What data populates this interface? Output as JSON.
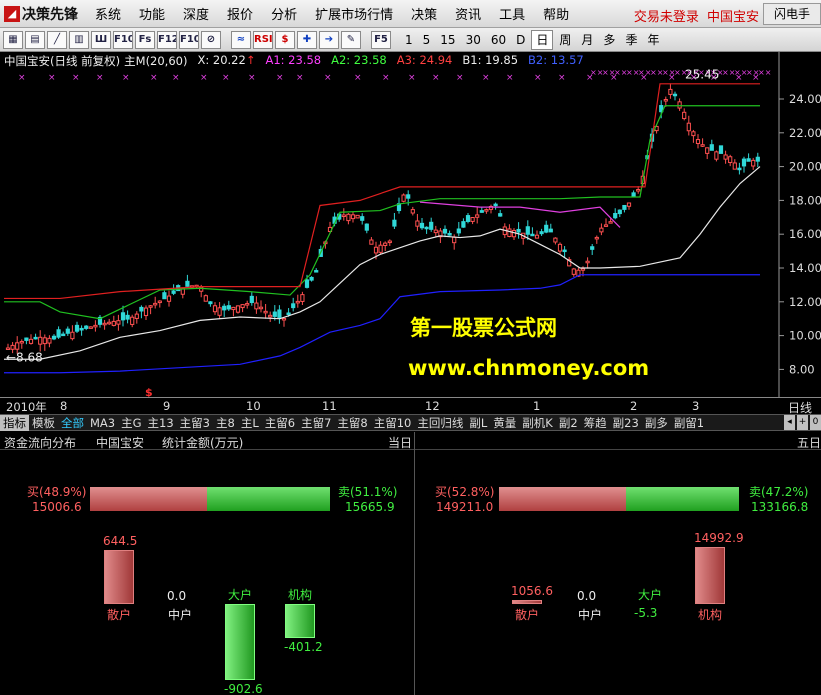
{
  "menubar": {
    "logo": "决策先锋",
    "items": [
      "系统",
      "功能",
      "深度",
      "报价",
      "分析",
      "扩展市场行情",
      "决策",
      "资讯",
      "工具",
      "帮助"
    ],
    "status": "交易未登录",
    "stock": "中国宝安",
    "flash_button": "闪电手"
  },
  "toolbar": {
    "icons": [
      "grid",
      "table",
      "line",
      "bar",
      "kline",
      "F10",
      "F9",
      "F12",
      "F10",
      "zoom",
      "wave",
      "RSI",
      "$",
      "cross",
      "arrow",
      "pen",
      "F5"
    ],
    "icon_labels": [
      "▦",
      "▤",
      "╱",
      "▥",
      "Ш",
      "F10",
      "Fs",
      "F12",
      "F10",
      "⊘",
      "≈",
      "RSI",
      "$",
      "✚",
      "➔",
      "✎",
      "F5"
    ],
    "periods": [
      "1",
      "5",
      "15",
      "30",
      "60",
      "D",
      "日",
      "周",
      "月",
      "多",
      "季",
      "年"
    ],
    "selected_period": "日"
  },
  "chart_header": {
    "stock": "中国宝安(日线 前复权)",
    "indicator": "主M(20,60)",
    "x": "X: 20.22",
    "x_arrow": "↑",
    "a1": "A1: 23.58",
    "a2": "A2: 23.58",
    "a3": "A3: 24.94",
    "b1": "B1: 19.85",
    "b2": "B2: 13.57"
  },
  "price_chart": {
    "y_ticks": [
      "24.00",
      "22.00",
      "20.00",
      "18.00",
      "16.00",
      "14.00",
      "12.00",
      "10.00",
      "8.00"
    ],
    "y_values": [
      24,
      22,
      20,
      18,
      16,
      14,
      12,
      10,
      8
    ],
    "low_label": "←8.68",
    "high_label": "25.45",
    "watermark_line1": "第一股票公式网",
    "watermark_line2": "www.chnmoney.com",
    "dollar_marker": "$"
  },
  "x_axis": {
    "labels": [
      "2010年",
      "8",
      "9",
      "10",
      "11",
      "12",
      "1",
      "2",
      "3"
    ],
    "period_label": "日线"
  },
  "indicator_tabs": [
    "指标",
    "模板",
    "全部",
    "MA3",
    "主G",
    "主13",
    "主留3",
    "主8",
    "主L",
    "主留6",
    "主留7",
    "主留8",
    "主留10",
    "主回归线",
    "副L",
    "黄量",
    "副机K",
    "副2",
    "筹趋",
    "副23",
    "副多",
    "副留1"
  ],
  "active_tab": "全部",
  "flow_header": {
    "title": "资金流向分布",
    "stock": "中国宝安",
    "stat": "统计金额(万元)",
    "left_period": "当日",
    "right_period": "五日"
  },
  "left_panel": {
    "buy_label": "买(48.9%)",
    "buy_value": "15006.6",
    "sell_label": "卖(51.1%)",
    "sell_value": "15665.9",
    "buy_ratio": 0.489,
    "bars": [
      {
        "name": "散户",
        "value": 644.5,
        "text": "644.5"
      },
      {
        "name": "中户",
        "value": 0.0,
        "text": "0.0"
      },
      {
        "name": "大户",
        "value": -902.6,
        "text": "-902.6"
      },
      {
        "name": "机构",
        "value": -401.2,
        "text": "-401.2"
      }
    ]
  },
  "right_panel": {
    "buy_label": "买(52.8%)",
    "buy_value": "149211.0",
    "sell_label": "卖(47.2%)",
    "sell_value": "133166.8",
    "buy_ratio": 0.528,
    "bars": [
      {
        "name": "散户",
        "value": 1056.6,
        "text": "1056.6"
      },
      {
        "name": "中户",
        "value": 0.0,
        "text": "0.0"
      },
      {
        "name": "大户",
        "value": -5.3,
        "text": "-5.3"
      },
      {
        "name": "机构",
        "value": 14992.9,
        "text": "14992.9"
      }
    ]
  },
  "colors": {
    "up": "#ff5050",
    "down": "#30d8d8",
    "ma_white": "#e8e8e8",
    "line_blue": "#2020ff",
    "line_green": "#20c020",
    "line_red": "#e02020",
    "line_magenta": "#e040e0",
    "watermark": "#ffff00",
    "buy_bar": "#d06060",
    "sell_bar": "#30c030"
  }
}
